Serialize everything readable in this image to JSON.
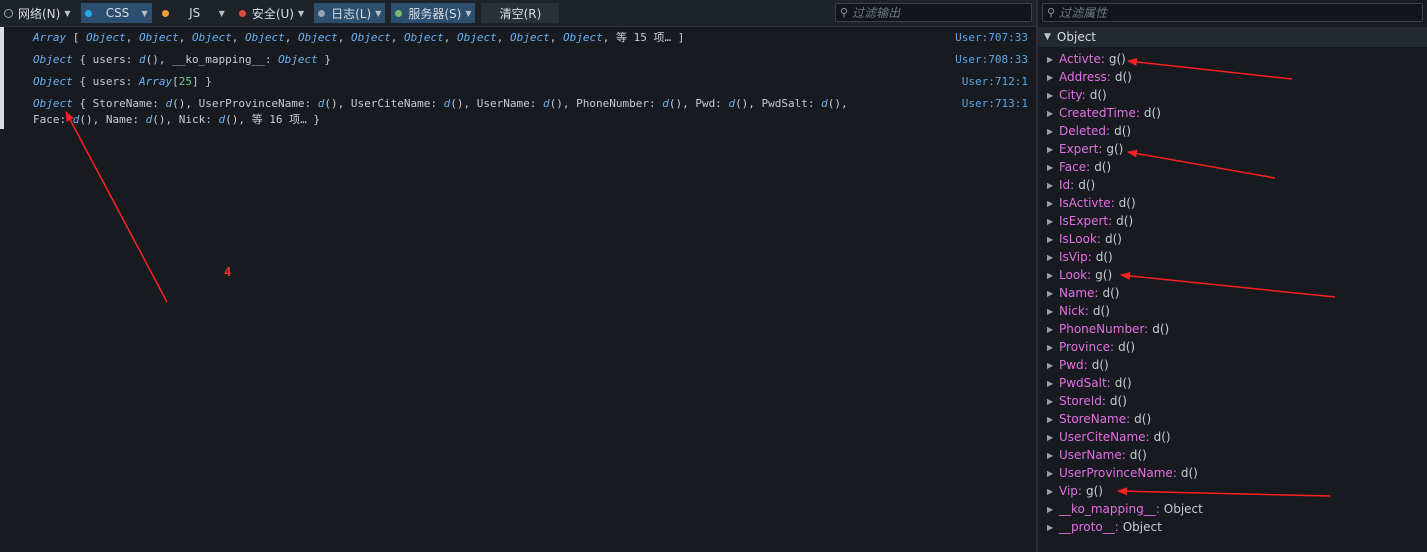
{
  "toolbar": {
    "items": [
      {
        "label": "网络(N)",
        "dot": "",
        "active": false
      },
      {
        "label": "CSS",
        "dot": "#2aa7e8",
        "active": true
      },
      {
        "label": "JS",
        "dot": "#f0a030",
        "active": false
      },
      {
        "label": "安全(U)",
        "dot": "#e04848",
        "active": false
      },
      {
        "label": "日志(L)",
        "dot": "#9aa4b0",
        "active": true
      },
      {
        "label": "服务器(S)",
        "dot": "#7ab870",
        "active": true
      }
    ],
    "clear_label": "清空(R)",
    "filter_placeholder": "过滤输出"
  },
  "console": {
    "rows": [
      {
        "text": "<span class=\"kw\">Array</span> [ <span class=\"kw\">Object</span>, <span class=\"kw\">Object</span>, <span class=\"kw\">Object</span>, <span class=\"kw\">Object</span>, <span class=\"kw\">Object</span>, <span class=\"kw\">Object</span>, <span class=\"kw\">Object</span>, <span class=\"kw\">Object</span>, <span class=\"kw\">Object</span>, <span class=\"kw\">Object</span>, 等 15 项… ]",
        "src": "User:707:33"
      },
      {
        "text": "<span class=\"kw\">Object</span> { users: <span class=\"kw\">d</span>(), __ko_mapping__: <span class=\"kw\">Object</span> }",
        "src": "User:708:33"
      },
      {
        "text": "<span class=\"kw\">Object</span> { users: <span class=\"kw\">Array</span>[<span class=\"num\">25</span>] }",
        "src": "User:712:1"
      },
      {
        "text": "<span class=\"kw\">Object</span> { StoreName: <span class=\"kw\">d</span>(), UserProvinceName: <span class=\"kw\">d</span>(), UserCiteName: <span class=\"kw\">d</span>(), UserName: <span class=\"kw\">d</span>(), PhoneNumber: <span class=\"kw\">d</span>(), Pwd: <span class=\"kw\">d</span>(), PwdSalt: <span class=\"kw\">d</span>(),<br>Face: <span class=\"kw\">d</span>(), Name: <span class=\"kw\">d</span>(), Nick: <span class=\"kw\">d</span>(), 等 16 项… }",
        "src": "User:713:1"
      }
    ],
    "annotation": "4"
  },
  "sidebar": {
    "filter_placeholder": "过滤属性",
    "root_label": "Object",
    "props": [
      {
        "name": "Activte:",
        "value": "g()"
      },
      {
        "name": "Address:",
        "value": "d()"
      },
      {
        "name": "City:",
        "value": "d()"
      },
      {
        "name": "CreatedTime:",
        "value": "d()"
      },
      {
        "name": "Deleted:",
        "value": "d()"
      },
      {
        "name": "Expert:",
        "value": "g()"
      },
      {
        "name": "Face:",
        "value": "d()"
      },
      {
        "name": "Id:",
        "value": "d()"
      },
      {
        "name": "IsActivte:",
        "value": "d()"
      },
      {
        "name": "IsExpert:",
        "value": "d()"
      },
      {
        "name": "IsLook:",
        "value": "d()"
      },
      {
        "name": "IsVip:",
        "value": "d()"
      },
      {
        "name": "Look:",
        "value": "g()"
      },
      {
        "name": "Name:",
        "value": "d()"
      },
      {
        "name": "Nick:",
        "value": "d()"
      },
      {
        "name": "PhoneNumber:",
        "value": "d()"
      },
      {
        "name": "Province:",
        "value": "d()"
      },
      {
        "name": "Pwd:",
        "value": "d()"
      },
      {
        "name": "PwdSalt:",
        "value": "d()"
      },
      {
        "name": "StoreId:",
        "value": "d()"
      },
      {
        "name": "StoreName:",
        "value": "d()"
      },
      {
        "name": "UserCiteName:",
        "value": "d()"
      },
      {
        "name": "UserName:",
        "value": "d()"
      },
      {
        "name": "UserProvinceName:",
        "value": "d()"
      },
      {
        "name": "Vip:",
        "value": "g()"
      },
      {
        "name": "__ko_mapping__:",
        "value": "Object"
      },
      {
        "name": "__proto__:",
        "value": "Object"
      }
    ]
  },
  "colors": {
    "accent": "#2c4f6f",
    "prop_name": "#e36fe3",
    "annotation": "#ff3030"
  }
}
